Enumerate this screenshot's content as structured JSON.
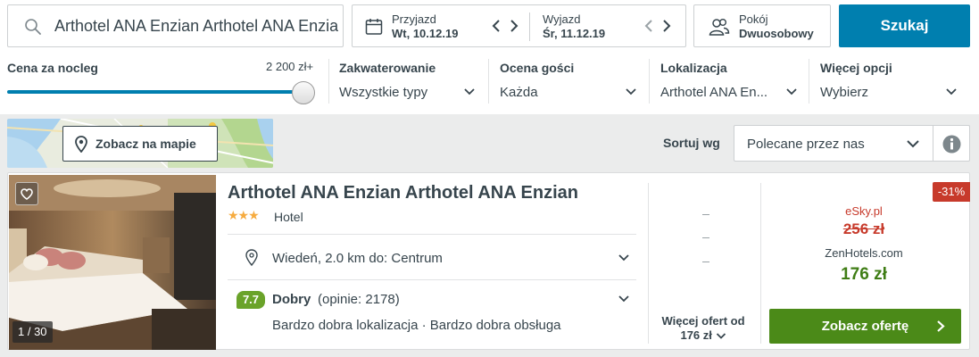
{
  "search": {
    "query": "Arthotel ANA Enzian Arthotel ANA Enzian"
  },
  "dates": {
    "checkin_label": "Przyjazd",
    "checkin_value": "Wt, 10.12.19",
    "checkout_label": "Wyjazd",
    "checkout_value": "Śr, 11.12.19"
  },
  "room": {
    "label": "Pokój",
    "value": "Dwuosobowy"
  },
  "search_button": "Szukaj",
  "filters": {
    "price_title": "Cena za nocleg",
    "price_max": "2 200 zł+",
    "price_slider_fraction": 1.0,
    "accommodation_title": "Zakwaterowanie",
    "accommodation_value": "Wszystkie typy",
    "rating_title": "Ocena gości",
    "rating_value": "Każda",
    "location_title": "Lokalizacja",
    "location_value": "Arthotel ANA En...",
    "more_title": "Więcej opcji",
    "more_value": "Wybierz"
  },
  "map_button": "Zobacz na mapie",
  "sort": {
    "label": "Sortuj wg",
    "value": "Polecane przez nas"
  },
  "hotel": {
    "name": "Arthotel ANA Enzian Arthotel ANA Enzian",
    "stars": "★★★",
    "type": "Hotel",
    "location": "Wiedeń, 2.0 km do: Centrum",
    "rating_score": "7.7",
    "rating_word": "Dobry",
    "rating_count": "(opinie: 2178)",
    "highlights": "Bardzo dobra lokalizacja · Bardzo dobra obsługa",
    "photo_counter": "1 / 30"
  },
  "offers": {
    "placeholder_dashes": [
      "–",
      "–",
      "–"
    ],
    "more_offers_line1": "Więcej ofert od",
    "more_offers_price": "176 zł",
    "discount": "-31%",
    "old_provider": "eSky.pl",
    "old_price": "256 zł",
    "new_provider": "ZenHotels.com",
    "new_price": "176 zł",
    "cta": "Zobacz ofertę"
  },
  "colors": {
    "primary_blue": "#007faf",
    "cta_green": "#4b8a18",
    "rating_green": "#6aa32a",
    "discount_red": "#c73a2b",
    "star_orange": "#f6ab3f"
  }
}
